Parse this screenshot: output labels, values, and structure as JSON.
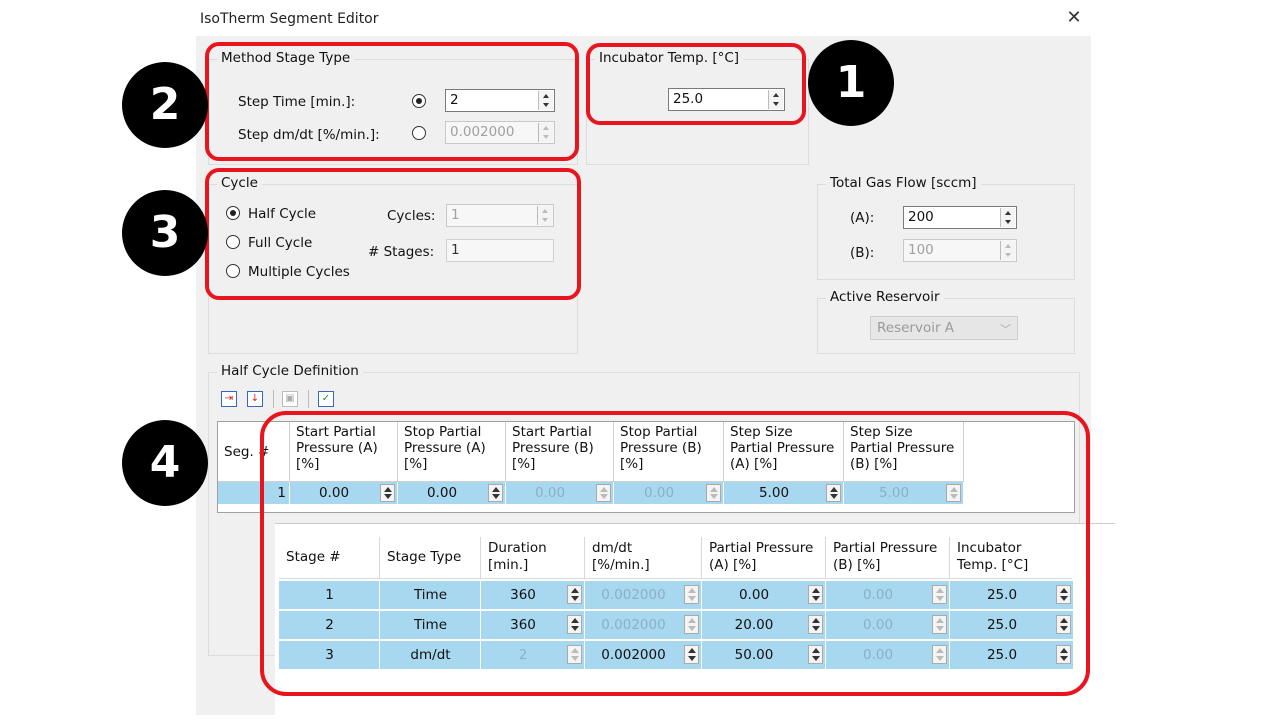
{
  "window": {
    "title": "IsoTherm Segment Editor",
    "close_glyph": "✕"
  },
  "method_stage_type": {
    "title": "Method Stage Type",
    "step_time_label": "Step Time [min.]:",
    "step_time_value": "2",
    "step_dmdt_label": "Step dm/dt [%/min.]:",
    "step_dmdt_value": "0.002000",
    "selected": "step_time"
  },
  "incubator": {
    "title": "Incubator Temp. [°C]",
    "value": "25.0"
  },
  "cycle": {
    "title": "Cycle",
    "options": [
      "Half Cycle",
      "Full Cycle",
      "Multiple Cycles"
    ],
    "selected": "Half Cycle",
    "cycles_label": "Cycles:",
    "cycles_value": "1",
    "stages_label": "# Stages:",
    "stages_value": "1"
  },
  "gas_flow": {
    "title": "Total Gas Flow [sccm]",
    "a_label": "(A):",
    "a_value": "200",
    "b_label": "(B):",
    "b_value": "100"
  },
  "reservoir": {
    "title": "Active Reservoir",
    "value": "Reservoir A",
    "dropdown_glyph": "﹀"
  },
  "half_cycle": {
    "title": "Half Cycle Definition",
    "toolbar_icons": [
      "add-row-icon",
      "insert-row-icon",
      "copy-icon",
      "paste-icon"
    ],
    "headers": [
      "Seg. #",
      "Start Partial Pressure (A) [%]",
      "Stop Partial Pressure (A) [%]",
      "Start Partial Pressure (B) [%]",
      "Stop Partial Pressure (B) [%]",
      "Step Size Partial Pressure (A) [%]",
      "Step Size Partial Pressure (B) [%]"
    ],
    "rows": [
      {
        "seg": "1",
        "values": [
          "0.00",
          "0.00",
          "0.00",
          "0.00",
          "5.00",
          "5.00"
        ]
      }
    ]
  },
  "stages": {
    "headers": [
      "Stage #",
      "Stage Type",
      "Duration [min.]",
      "dm/dt [%/min.]",
      "Partial Pressure (A) [%]",
      "Partial Pressure (B) [%]",
      "Incubator Temp. [°C]"
    ],
    "rows": [
      {
        "stage": "1",
        "type": "Time",
        "duration": "360",
        "dmdt": "0.002000",
        "ppa": "0.00",
        "ppb": "0.00",
        "temp": "25.0"
      },
      {
        "stage": "2",
        "type": "Time",
        "duration": "360",
        "dmdt": "0.002000",
        "ppa": "20.00",
        "ppb": "0.00",
        "temp": "25.0"
      },
      {
        "stage": "3",
        "type": "dm/dt",
        "duration": "2",
        "dmdt": "0.002000",
        "ppa": "50.00",
        "ppb": "0.00",
        "temp": "25.0"
      }
    ]
  },
  "annotations": {
    "badge_1": "1",
    "badge_2": "2",
    "badge_3": "3",
    "badge_4": "4",
    "color": "#e8141e"
  },
  "colors": {
    "row_highlight": "#a8d8f0",
    "dialog_bg": "#f0f0f0"
  }
}
